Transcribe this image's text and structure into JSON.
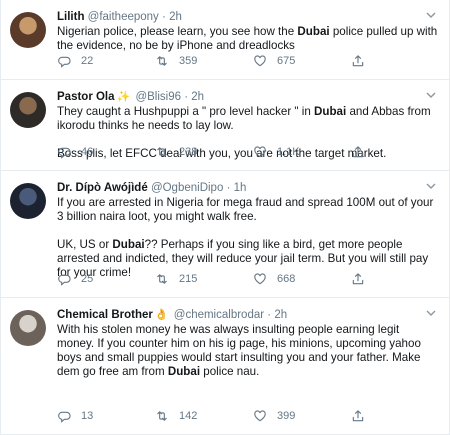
{
  "tweets": [
    {
      "name": "Lilith",
      "handle": "@faitheepony",
      "dot": "·",
      "time": "2h",
      "badge": "",
      "body": [
        [
          {
            "t": "Nigerian police, please learn, you see how the "
          },
          {
            "t": "Dubai",
            "b": true
          },
          {
            "t": " police pulled up with the evidence, no be by iPhone and dreadlocks"
          }
        ]
      ],
      "replies": "22",
      "retweets": "359",
      "likes": "675",
      "avatar_colors": [
        "#c79a6b",
        "#5a3b2a"
      ]
    },
    {
      "name": "Pastor Ola",
      "handle": "@Blisi96",
      "dot": "·",
      "time": "2h",
      "badge": "✨",
      "body": [
        [
          {
            "t": "They caught a Hushpuppi a \" pro level hacker \" in "
          },
          {
            "t": "Dubai",
            "b": true
          },
          {
            "t": " and Abbas from ikorodu thinks he needs to lay low."
          }
        ],
        [
          {
            "t": "Boss plis, let EFCC deal with you, you are not the target market."
          }
        ]
      ],
      "replies": "46",
      "retweets": "238",
      "likes": "1.1K",
      "avatar_colors": [
        "#8a6a4f",
        "#2e2a28"
      ]
    },
    {
      "name": "Dr. Dípò Awójìdé",
      "handle": "@OgbeniDipo",
      "dot": "·",
      "time": "1h",
      "badge": "",
      "body": [
        [
          {
            "t": "If you are arrested in Nigeria for mega fraud and spread 100M out of your 3 billion naira loot, you might walk free."
          }
        ],
        [
          {
            "t": "UK, US or "
          },
          {
            "t": "Dubai",
            "b": true
          },
          {
            "t": "?? Perhaps if you sing like a bird, get more people arrested and indicted, they will reduce your jail term. But you will still pay for your crime!"
          }
        ]
      ],
      "replies": "25",
      "retweets": "215",
      "likes": "668",
      "avatar_colors": [
        "#4a5a7a",
        "#1c2230"
      ]
    },
    {
      "name": "Chemical Brother",
      "handle": "@chemicalbrodar",
      "dot": "·",
      "time": "2h",
      "badge": "👌",
      "body": [
        [
          {
            "t": "With his stolen money he was always insulting people earning legit money. If you counter him on his ig page, his minions, upcoming yahoo boys and small puppies would start insulting you and your father. Make dem go free am from "
          },
          {
            "t": "Dubai",
            "b": true
          },
          {
            "t": " police nau."
          }
        ]
      ],
      "replies": "13",
      "retweets": "142",
      "likes": "399",
      "avatar_colors": [
        "#d8d2cc",
        "#6d625a"
      ]
    }
  ],
  "colors": {
    "text": "#14171a",
    "muted": "#657786",
    "border": "#e6ecf0"
  }
}
